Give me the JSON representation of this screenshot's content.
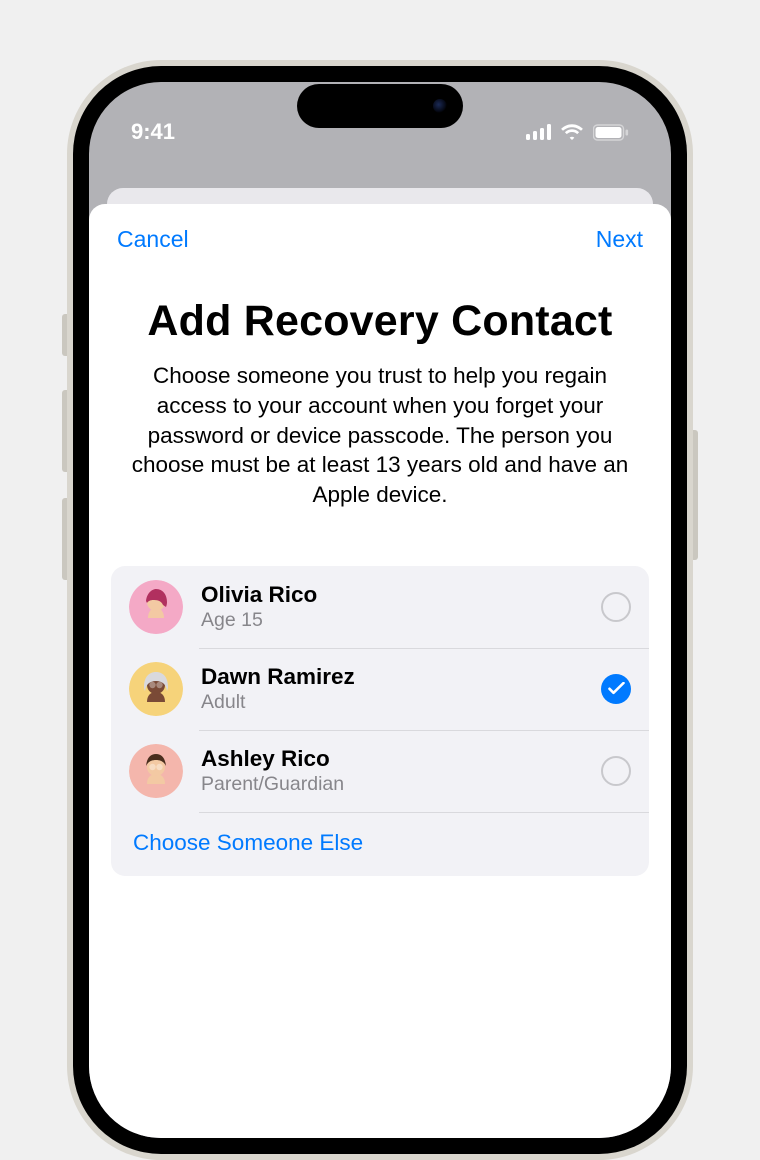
{
  "statusbar": {
    "time": "9:41"
  },
  "nav": {
    "cancel": "Cancel",
    "next": "Next"
  },
  "heading": "Add Recovery Contact",
  "description": "Choose someone you trust to help you regain access to your account when you forget your password or device passcode. The person you choose must be at least 13 years old and have an Apple device.",
  "contacts": [
    {
      "name": "Olivia Rico",
      "sub": "Age 15",
      "selected": false,
      "avatar_bg": "#f4a9c6"
    },
    {
      "name": "Dawn Ramirez",
      "sub": "Adult",
      "selected": true,
      "avatar_bg": "#f6d37a"
    },
    {
      "name": "Ashley Rico",
      "sub": "Parent/Guardian",
      "selected": false,
      "avatar_bg": "#f4b6ac"
    }
  ],
  "choose_else": "Choose Someone Else",
  "colors": {
    "tint": "#007aff"
  }
}
